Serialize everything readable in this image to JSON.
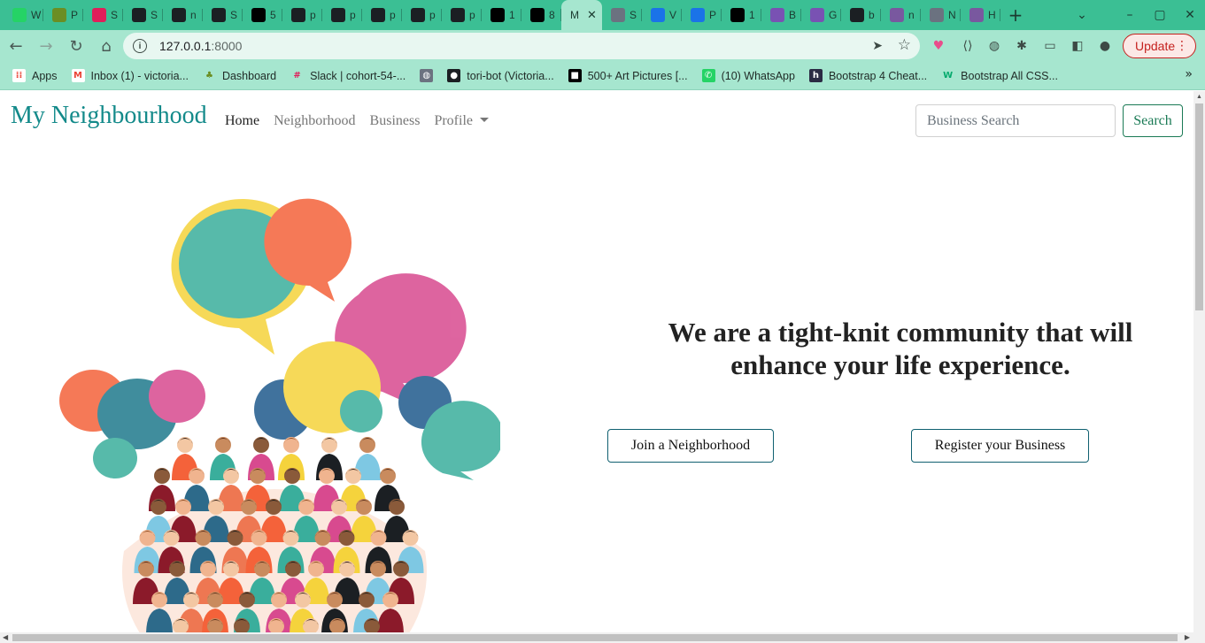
{
  "browser": {
    "tabs": [
      {
        "letter": "W",
        "icon": "whatsapp-icon",
        "color": "#25d366"
      },
      {
        "letter": "P",
        "icon": "tree-icon",
        "color": "#6b8e23"
      },
      {
        "letter": "S",
        "icon": "slack-icon",
        "color": "#e01e5a"
      },
      {
        "letter": "S",
        "icon": "github-icon",
        "color": "#1b1f23"
      },
      {
        "letter": "n",
        "icon": "github-icon",
        "color": "#1b1f23"
      },
      {
        "letter": "S",
        "icon": "github-icon",
        "color": "#1b1f23"
      },
      {
        "letter": "5",
        "icon": "unsplash-icon",
        "color": "#000000"
      },
      {
        "letter": "p",
        "icon": "github-icon",
        "color": "#1b1f23"
      },
      {
        "letter": "p",
        "icon": "github-icon",
        "color": "#1b1f23"
      },
      {
        "letter": "p",
        "icon": "github-icon",
        "color": "#1b1f23"
      },
      {
        "letter": "p",
        "icon": "github-icon",
        "color": "#1b1f23"
      },
      {
        "letter": "p",
        "icon": "github-icon",
        "color": "#1b1f23"
      },
      {
        "letter": "1",
        "icon": "istock-icon",
        "color": "#000000"
      },
      {
        "letter": "8",
        "icon": "istock-icon",
        "color": "#000000"
      },
      {
        "letter": "M",
        "icon": "",
        "color": "#a6e6cf",
        "active": true
      },
      {
        "letter": "S",
        "icon": "globe-icon",
        "color": "#6b7280"
      },
      {
        "letter": "V",
        "icon": "google-icon",
        "color": "#1a73e8"
      },
      {
        "letter": "P",
        "icon": "google-icon",
        "color": "#1a73e8"
      },
      {
        "letter": "1",
        "icon": "unsplash-icon",
        "color": "#000000"
      },
      {
        "letter": "B",
        "icon": "bootstrap-icon",
        "color": "#7952b3"
      },
      {
        "letter": "G",
        "icon": "bootstrap-icon",
        "color": "#7952b3"
      },
      {
        "letter": "b",
        "icon": "github-icon",
        "color": "#1b1f23"
      },
      {
        "letter": "n",
        "icon": "heroku-icon",
        "color": "#79589f"
      },
      {
        "letter": "N",
        "icon": "globe-icon",
        "color": "#6b7280"
      },
      {
        "letter": "H",
        "icon": "heroku-icon",
        "color": "#79589f"
      }
    ],
    "url_host": "127.0.0.1",
    "url_port": ":8000",
    "update_label": "Update",
    "bookmarks": [
      {
        "label": "Apps",
        "icon": "apps-grid-icon"
      },
      {
        "label": "Inbox (1) - victoria...",
        "icon": "gmail-icon"
      },
      {
        "label": "Dashboard",
        "icon": "tree-icon"
      },
      {
        "label": "Slack | cohort-54-...",
        "icon": "slack-icon"
      },
      {
        "label": "",
        "icon": "globe-icon"
      },
      {
        "label": "tori-bot (Victoria...",
        "icon": "github-icon"
      },
      {
        "label": "500+ Art Pictures [...",
        "icon": "unsplash-icon"
      },
      {
        "label": "(10) WhatsApp",
        "icon": "whatsapp-icon"
      },
      {
        "label": "Bootstrap 4 Cheat...",
        "icon": "hackr-icon"
      },
      {
        "label": "Bootstrap All CSS...",
        "icon": "w3-icon"
      }
    ]
  },
  "site": {
    "brand": "My Neighbourhood",
    "nav": {
      "home": "Home",
      "neighborhood": "Neighborhood",
      "business": "Business",
      "profile": "Profile"
    },
    "search_placeholder": "Business Search",
    "search_button": "Search"
  },
  "hero": {
    "tagline": "We are a tight-knit community that will enhance your life experience.",
    "join_button": "Join a Neighborhood",
    "register_button": "Register your Business"
  },
  "colors": {
    "chrome_tabs": "#3bbf94",
    "chrome_toolbar": "#a6e6cf",
    "brand": "#138a8a",
    "search_button": "#1a7a55"
  }
}
